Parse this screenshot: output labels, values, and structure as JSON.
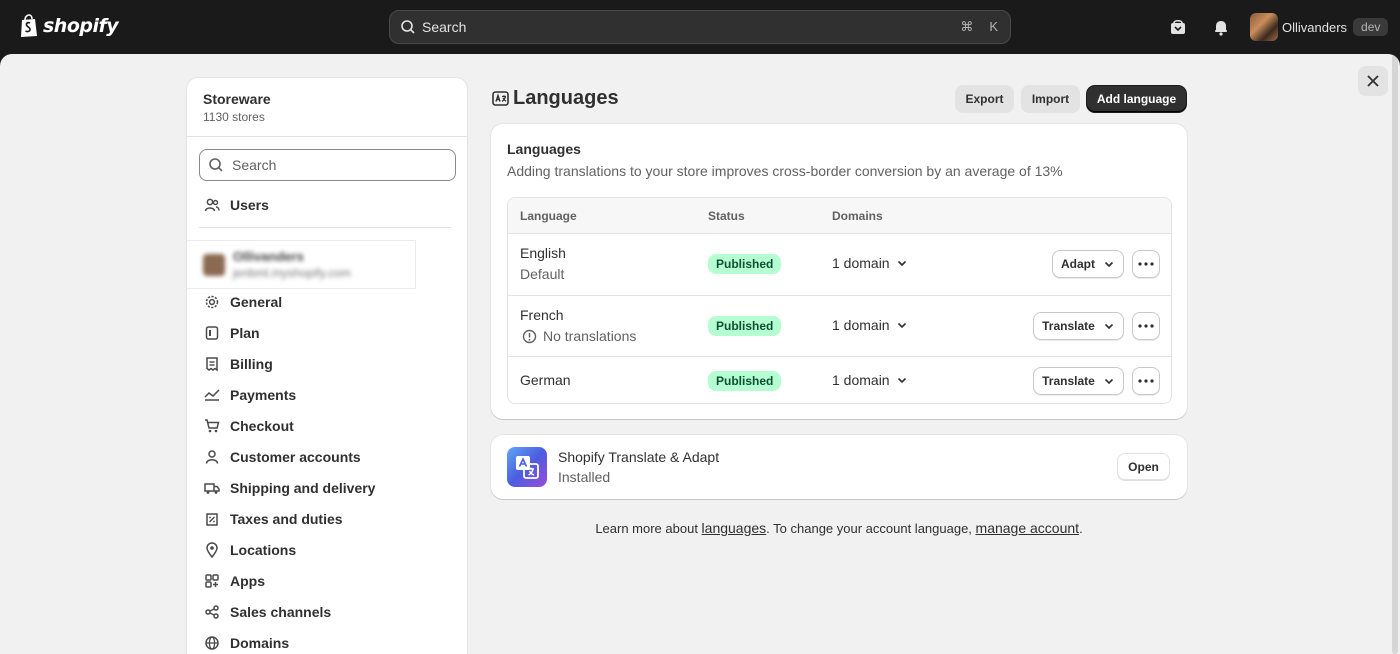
{
  "topbar": {
    "brand": "shopify",
    "search_placeholder": "Search",
    "shortcut_cmd": "⌘",
    "shortcut_key": "K",
    "user_name": "Ollivanders",
    "env_badge": "dev"
  },
  "sidebar": {
    "store_name": "Storeware",
    "store_count": "1130 stores",
    "search_placeholder": "Search",
    "users_label": "Users",
    "account_name": "Ollivanders",
    "account_email": "jenbml.myshopify.com",
    "items": [
      {
        "label": "General",
        "icon": "gear-icon"
      },
      {
        "label": "Plan",
        "icon": "plan-icon"
      },
      {
        "label": "Billing",
        "icon": "billing-icon"
      },
      {
        "label": "Payments",
        "icon": "payments-icon"
      },
      {
        "label": "Checkout",
        "icon": "cart-icon"
      },
      {
        "label": "Customer accounts",
        "icon": "person-icon"
      },
      {
        "label": "Shipping and delivery",
        "icon": "truck-icon"
      },
      {
        "label": "Taxes and duties",
        "icon": "tax-icon"
      },
      {
        "label": "Locations",
        "icon": "location-icon"
      },
      {
        "label": "Apps",
        "icon": "apps-icon"
      },
      {
        "label": "Sales channels",
        "icon": "channels-icon"
      },
      {
        "label": "Domains",
        "icon": "globe-icon"
      }
    ]
  },
  "page": {
    "title": "Languages",
    "export_label": "Export",
    "import_label": "Import",
    "add_label": "Add language"
  },
  "languages_card": {
    "title": "Languages",
    "description": "Adding translations to your store improves cross-border conversion by an average of 13%",
    "headers": {
      "language": "Language",
      "status": "Status",
      "domains": "Domains"
    },
    "rows": [
      {
        "name": "English",
        "sub": "Default",
        "status": "Published",
        "domains": "1 domain",
        "action": "Adapt"
      },
      {
        "name": "French",
        "sub": "No translations",
        "status": "Published",
        "domains": "1 domain",
        "action": "Translate"
      },
      {
        "name": "German",
        "sub": "",
        "status": "Published",
        "domains": "1 domain",
        "action": "Translate"
      }
    ]
  },
  "app_card": {
    "name": "Shopify Translate & Adapt",
    "status": "Installed",
    "open_label": "Open"
  },
  "footer": {
    "prefix": "Learn more about ",
    "link1": "languages",
    "middle": ". To change your account language, ",
    "link2": "manage account",
    "suffix": "."
  },
  "colors": {
    "topbar_bg": "#1a1a1a",
    "page_bg": "#f1f1f1",
    "badge_bg": "#b4fed2",
    "badge_text": "#0c5132",
    "primary_btn": "#303030"
  }
}
